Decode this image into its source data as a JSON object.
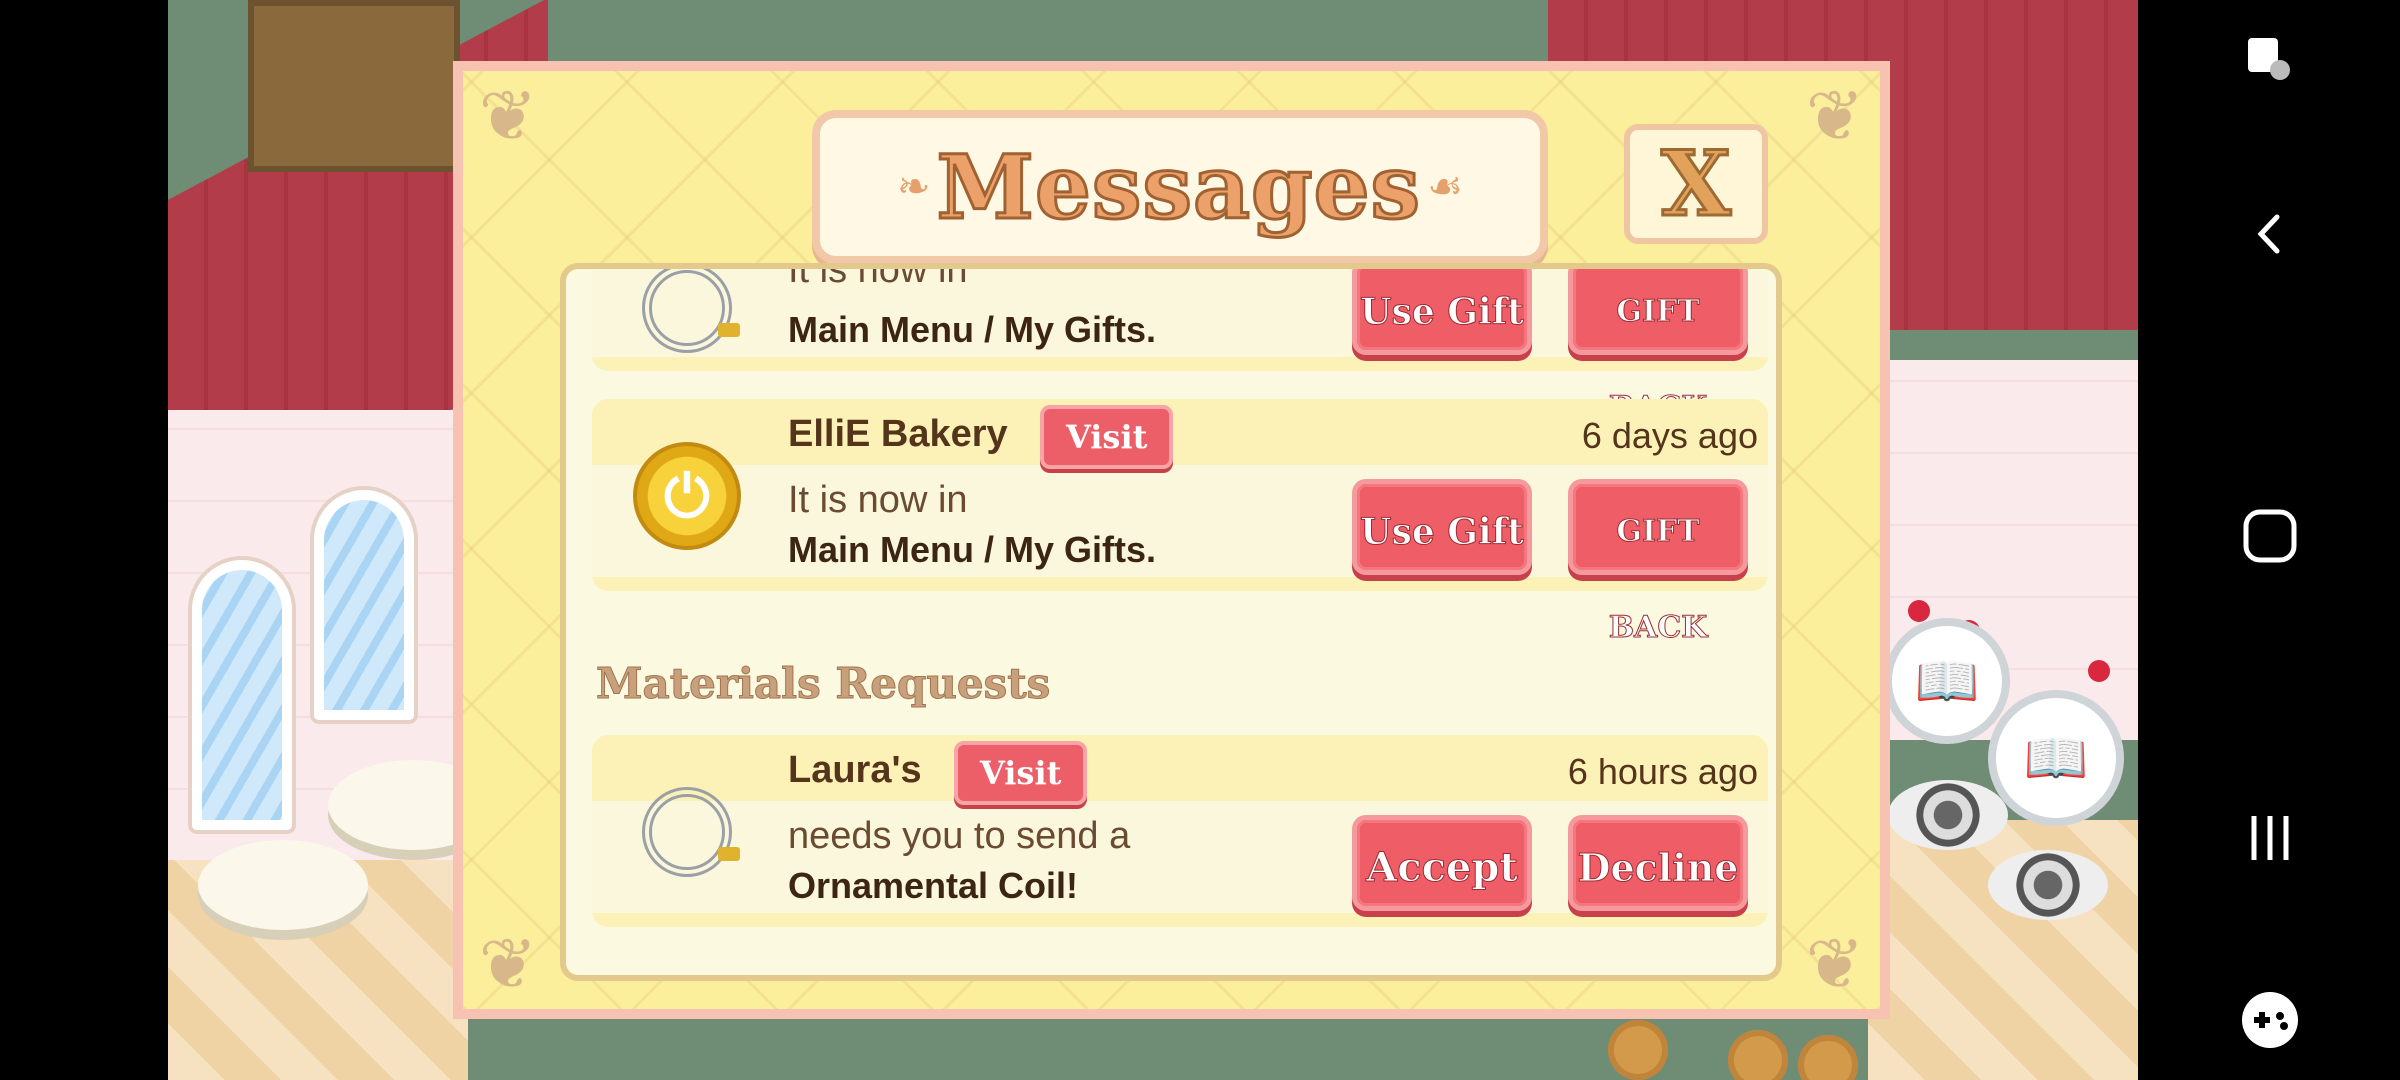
{
  "dialog": {
    "title": "Messages",
    "close_label": "X"
  },
  "gifts": [
    {
      "line1": "It is now in",
      "line2": "Main Menu / My Gifts.",
      "use_label": "Use Gift",
      "giftback_label": "GIFT BACK",
      "icon": "cable-coil-icon"
    },
    {
      "sender": "ElliE Bakery",
      "visit_label": "Visit",
      "time": "6 days ago",
      "line1": "It is now in",
      "line2": "Main Menu / My Gifts.",
      "use_label": "Use Gift",
      "giftback_label": "GIFT BACK",
      "icon": "gold-coin-icon"
    }
  ],
  "materials": {
    "section_title": "Materials Requests",
    "requests": [
      {
        "sender": "Laura's",
        "visit_label": "Visit",
        "time": "6 hours ago",
        "line1": "needs you to send a",
        "line2": "Ornamental Coil!",
        "accept_label": "Accept",
        "decline_label": "Decline",
        "icon": "ornamental-coil-icon"
      }
    ]
  },
  "navbar": {
    "icons": [
      "screen-pin-icon",
      "back-icon",
      "home-icon",
      "recents-icon",
      "game-tools-icon"
    ]
  },
  "colors": {
    "button_red": "#ef5d66",
    "dialog_yellow": "#fbef9c",
    "title_orange": "#eca16a"
  }
}
